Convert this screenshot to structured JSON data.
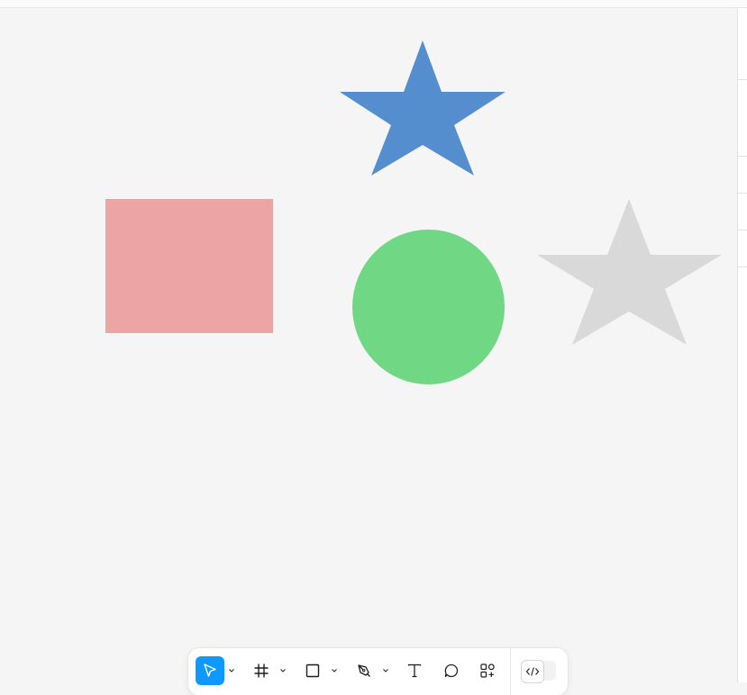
{
  "canvas": {
    "background": "#f5f5f5",
    "shapes": [
      {
        "name": "rectangle",
        "fill": "#eca4a4"
      },
      {
        "name": "circle",
        "fill": "#70d884"
      },
      {
        "name": "star",
        "fill": "#558ecf"
      },
      {
        "name": "star",
        "fill": "#d9d9d9"
      }
    ]
  },
  "toolbar": {
    "tools": [
      {
        "name": "move",
        "icon": "cursor-arrow-icon",
        "active": true,
        "has_menu": true
      },
      {
        "name": "frame",
        "icon": "frame-hash-icon",
        "active": false,
        "has_menu": true
      },
      {
        "name": "shape",
        "icon": "rectangle-icon",
        "active": false,
        "has_menu": true
      },
      {
        "name": "pen",
        "icon": "pen-nib-icon",
        "active": false,
        "has_menu": true
      },
      {
        "name": "text",
        "icon": "text-t-icon",
        "active": false,
        "has_menu": false
      },
      {
        "name": "comment",
        "icon": "comment-bubble-icon",
        "active": false,
        "has_menu": false
      },
      {
        "name": "resources",
        "icon": "shapes-plus-icon",
        "active": false,
        "has_menu": false
      },
      {
        "name": "dev-mode",
        "icon": "code-brackets-icon",
        "active": false,
        "has_menu": false
      }
    ],
    "accent_color": "#0d99ff"
  }
}
